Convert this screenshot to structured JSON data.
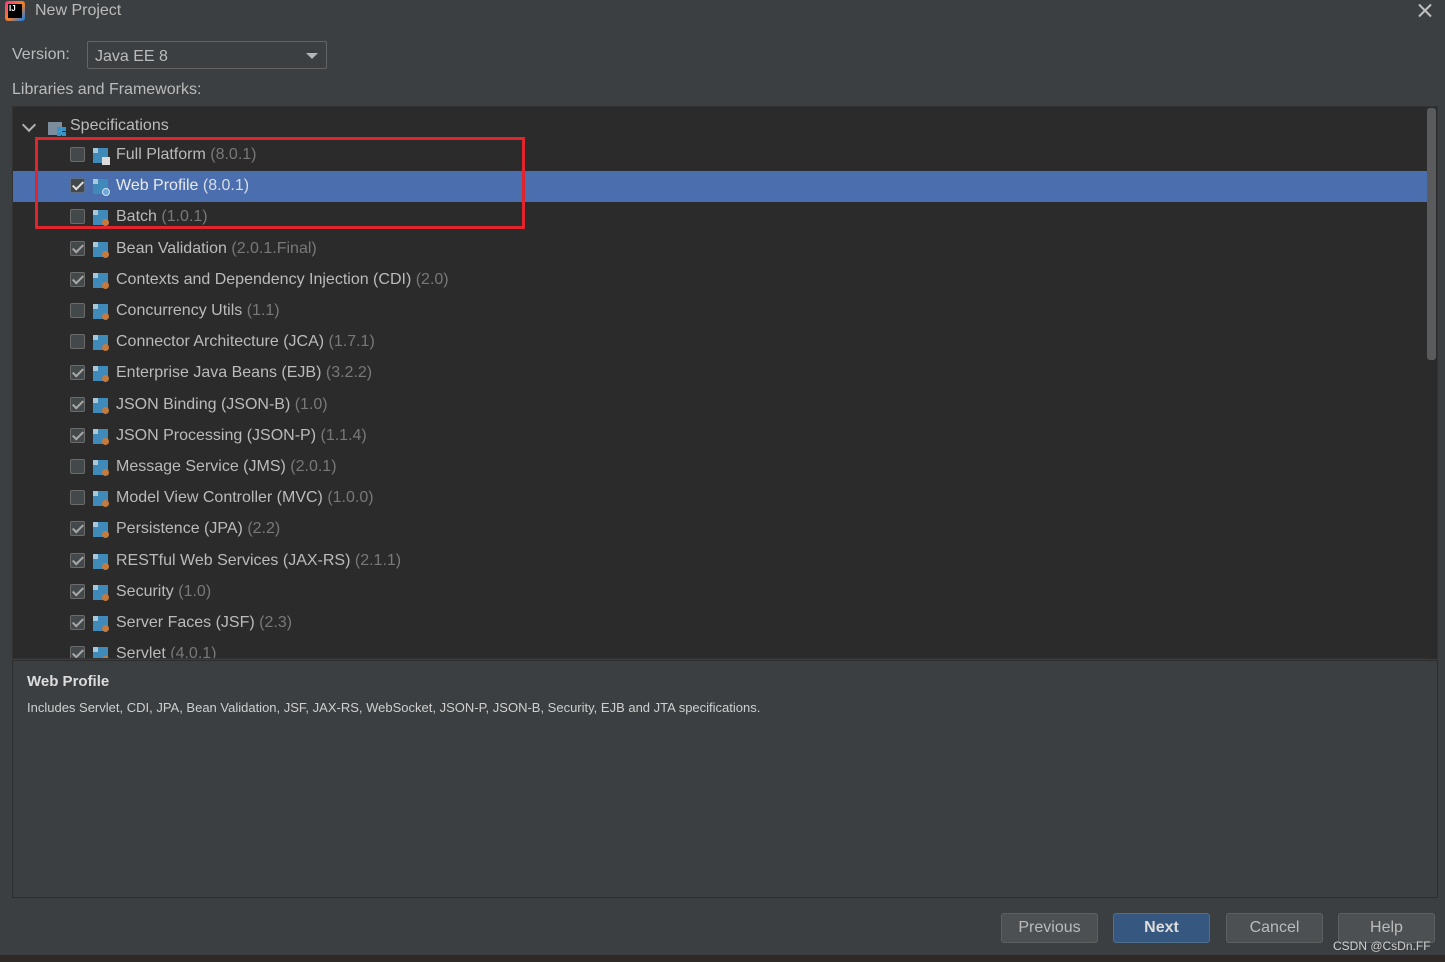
{
  "window": {
    "title": "New Project"
  },
  "version": {
    "label": "Version:",
    "value": "Java EE 8"
  },
  "libraries_label": "Libraries and Frameworks:",
  "tree": {
    "root_label": "Specifications",
    "items": [
      {
        "name": "Full Platform",
        "version": "(8.0.1)",
        "checked": false,
        "badge": "grid"
      },
      {
        "name": "Web Profile",
        "version": "(8.0.1)",
        "checked": true,
        "selected": true,
        "badge": "globe"
      },
      {
        "name": "Batch",
        "version": "(1.0.1)",
        "checked": false
      },
      {
        "name": "Bean Validation",
        "version": "(2.0.1.Final)",
        "checked": true
      },
      {
        "name": "Contexts and Dependency Injection (CDI)",
        "version": "(2.0)",
        "checked": true
      },
      {
        "name": "Concurrency Utils",
        "version": "(1.1)",
        "checked": false
      },
      {
        "name": "Connector Architecture (JCA)",
        "version": "(1.7.1)",
        "checked": false
      },
      {
        "name": "Enterprise Java Beans (EJB)",
        "version": "(3.2.2)",
        "checked": true
      },
      {
        "name": "JSON Binding (JSON-B)",
        "version": "(1.0)",
        "checked": true
      },
      {
        "name": "JSON Processing (JSON-P)",
        "version": "(1.1.4)",
        "checked": true
      },
      {
        "name": "Message Service (JMS)",
        "version": "(2.0.1)",
        "checked": false
      },
      {
        "name": "Model View Controller (MVC)",
        "version": "(1.0.0)",
        "checked": false
      },
      {
        "name": "Persistence (JPA)",
        "version": "(2.2)",
        "checked": true
      },
      {
        "name": "RESTful Web Services (JAX-RS)",
        "version": "(2.1.1)",
        "checked": true
      },
      {
        "name": "Security",
        "version": "(1.0)",
        "checked": true
      },
      {
        "name": "Server Faces (JSF)",
        "version": "(2.3)",
        "checked": true
      },
      {
        "name": "Servlet",
        "version": "(4.0.1)",
        "checked": true
      }
    ]
  },
  "description": {
    "title": "Web Profile",
    "text": "Includes Servlet, CDI, JPA, Bean Validation, JSF, JAX-RS, WebSocket, JSON-P, JSON-B, Security, EJB and JTA specifications."
  },
  "buttons": {
    "previous": "Previous",
    "next": "Next",
    "cancel": "Cancel",
    "help": "Help"
  },
  "watermark": "CSDN @CsDn.FF",
  "colors": {
    "selection": "#4b6eaf",
    "highlight_box": "#e0262c",
    "primary_button": "#365880"
  }
}
